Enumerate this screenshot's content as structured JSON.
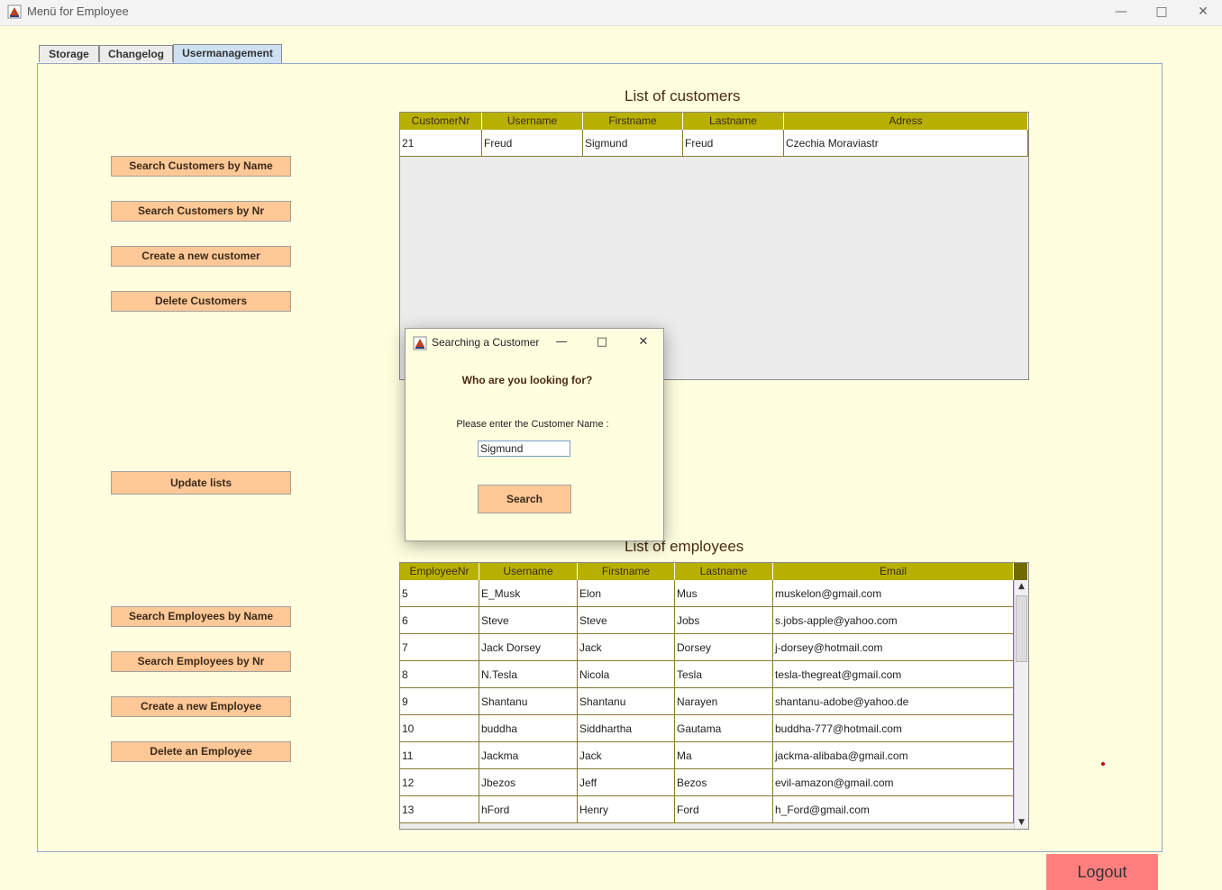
{
  "window": {
    "title": "Menü for Employee",
    "icons": {
      "app": "java-app-icon",
      "minimize": "minimize-icon",
      "maximize": "maximize-icon",
      "close": "close-icon"
    }
  },
  "tabs": [
    {
      "label": "Storage",
      "active": false
    },
    {
      "label": "Changelog",
      "active": false
    },
    {
      "label": "Usermanagement",
      "active": true
    }
  ],
  "customers": {
    "title": "List of customers",
    "buttons": {
      "search_by_name": "Search Customers by Name",
      "search_by_nr": "Search Customers by Nr",
      "create": "Create a new customer",
      "delete": "Delete Customers"
    },
    "columns": [
      "CustomerNr",
      "Username",
      "Firstname",
      "Lastname",
      "Adress"
    ],
    "rows": [
      [
        "21",
        "Freud",
        "Sigmund",
        "Freud",
        "Czechia Moraviastr"
      ]
    ]
  },
  "update_button": "Update lists",
  "employees": {
    "title": "List of employees",
    "buttons": {
      "search_by_name": "Search Employees by Name",
      "search_by_nr": "Search Employees by Nr",
      "create": "Create a new Employee",
      "delete": "Delete an Employee"
    },
    "columns": [
      "EmployeeNr",
      "Username",
      "Firstname",
      "Lastname",
      "Email"
    ],
    "rows": [
      [
        "5",
        "E_Musk",
        "Elon",
        "Mus",
        "muskelon@gmail.com"
      ],
      [
        "6",
        "Steve",
        "Steve",
        "Jobs",
        "s.jobs-apple@yahoo.com"
      ],
      [
        "7",
        "Jack Dorsey",
        "Jack",
        "Dorsey",
        "j-dorsey@hotmail.com"
      ],
      [
        "8",
        "N.Tesla",
        "Nicola",
        "Tesla",
        "tesla-thegreat@gmail.com"
      ],
      [
        "9",
        "Shantanu",
        "Shantanu",
        "Narayen",
        "shantanu-adobe@yahoo.de"
      ],
      [
        "10",
        "buddha",
        "Siddhartha",
        "Gautama",
        "buddha-777@hotmail.com"
      ],
      [
        "11",
        "Jackma",
        "Jack",
        "Ma",
        "jackma-alibaba@gmail.com"
      ],
      [
        "12",
        "Jbezos",
        "Jeff",
        "Bezos",
        "evil-amazon@gmail.com"
      ],
      [
        "13",
        "hFord",
        "Henry",
        "Ford",
        "h_Ford@gmail.com"
      ]
    ]
  },
  "logout_label": "Logout",
  "dialog": {
    "title": "Searching a Customer",
    "question": "Who are you looking for?",
    "prompt": "Please enter the Customer Name :",
    "input_value": "Sigmund",
    "search_label": "Search"
  },
  "colors": {
    "background": "#ffffe0",
    "button": "#ffc896",
    "table_header": "#b8b000",
    "logout": "#ff7f7f"
  }
}
